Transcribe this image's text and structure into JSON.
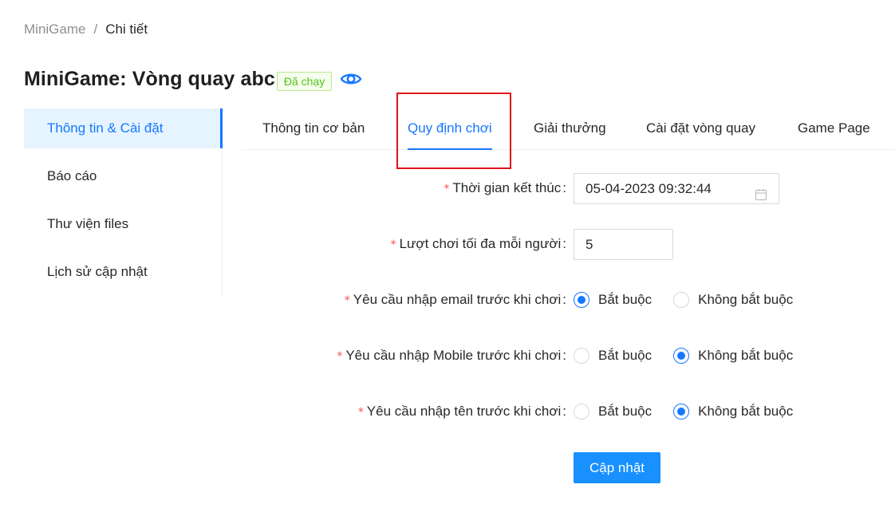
{
  "breadcrumb": {
    "root": "MiniGame",
    "separator": "/",
    "current": "Chi tiết"
  },
  "header": {
    "title": "MiniGame: Vòng quay abc",
    "status_badge": "Đã chạy",
    "view_icon": "eye-icon"
  },
  "sidebar": {
    "items": [
      {
        "label": "Thông tin & Cài đặt",
        "active": true
      },
      {
        "label": "Báo cáo",
        "active": false
      },
      {
        "label": "Thư viện files",
        "active": false
      },
      {
        "label": "Lịch sử cập nhật",
        "active": false
      }
    ]
  },
  "tabs": [
    {
      "label": "Thông tin cơ bản",
      "active": false
    },
    {
      "label": "Quy định chơi",
      "active": true
    },
    {
      "label": "Giải thưởng",
      "active": false
    },
    {
      "label": "Cài đặt vòng quay",
      "active": false
    },
    {
      "label": "Game Page",
      "active": false
    }
  ],
  "form": {
    "required_mark": "*",
    "colon": ":",
    "end_time": {
      "label": "Thời gian kết thúc",
      "value": "05-04-2023 09:32:44",
      "icon": "calendar-icon"
    },
    "max_plays": {
      "label": "Lượt chơi tối đa mỗi người",
      "value": "5"
    },
    "radio_options": {
      "required": "Bắt buộc",
      "optional": "Không bắt buộc"
    },
    "require_email": {
      "label": "Yêu cầu nhập email trước khi chơi",
      "selected": "required"
    },
    "require_mobile": {
      "label": "Yêu cầu nhập Mobile trước khi chơi",
      "selected": "optional"
    },
    "require_name": {
      "label": "Yêu cầu nhập tên trước khi chơi",
      "selected": "optional"
    },
    "submit_label": "Cập nhật"
  },
  "colors": {
    "primary": "#1677ff",
    "success": "#52c41a",
    "required": "#ff4d4f",
    "highlight": "#e0131b"
  }
}
